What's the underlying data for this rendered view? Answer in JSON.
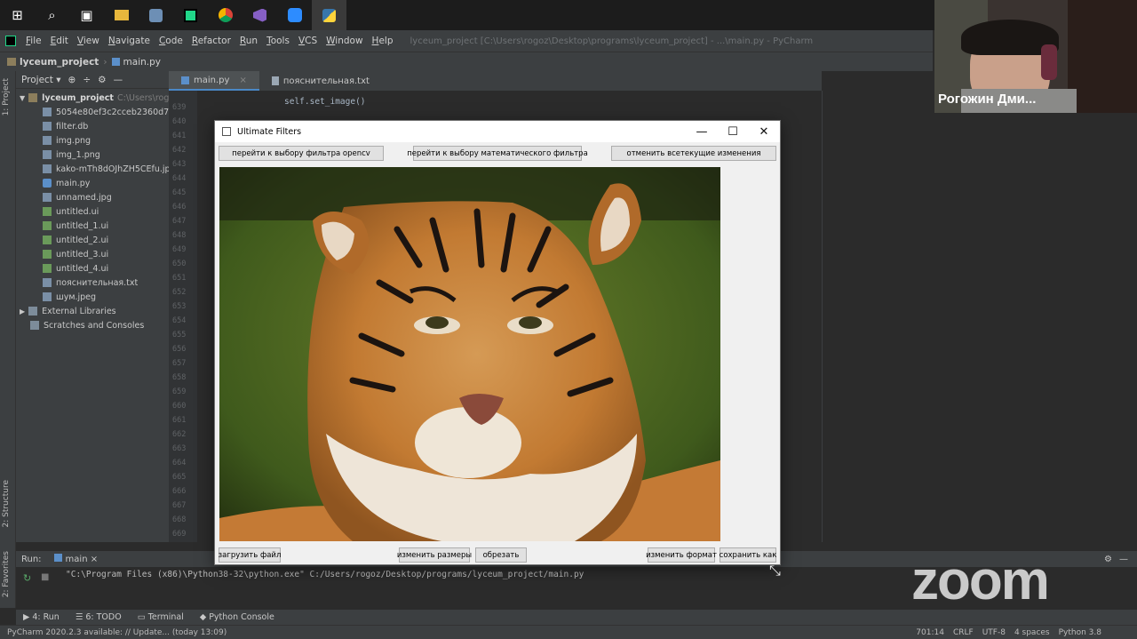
{
  "taskbar": {
    "icons": [
      "windows-start-icon",
      "search-icon",
      "task-view-icon",
      "file-explorer-icon",
      "app-icon",
      "pycharm-app-icon",
      "chrome-icon",
      "visual-studio-icon",
      "zoom-app-icon",
      "python-icon"
    ]
  },
  "menubar": {
    "items": [
      "File",
      "Edit",
      "View",
      "Navigate",
      "Code",
      "Refactor",
      "Run",
      "Tools",
      "VCS",
      "Window",
      "Help"
    ],
    "window_title": "lyceum_project [C:\\Users\\rogoz\\Desktop\\programs\\lyceum_project] - ...\\main.py - PyCharm"
  },
  "navbar": {
    "project": "lyceum_project",
    "file": "main.py"
  },
  "project_panel": {
    "header": "Project",
    "root": "lyceum_project",
    "root_path": "C:\\Users\\rogoz\\",
    "files": [
      {
        "name": "5054e80ef3c2cceb2360d77c5d",
        "kind": "file"
      },
      {
        "name": "filter.db",
        "kind": "file"
      },
      {
        "name": "img.png",
        "kind": "file"
      },
      {
        "name": "img_1.png",
        "kind": "file"
      },
      {
        "name": "kako-mTh8dOJhZH5CEfu.jpg",
        "kind": "file"
      },
      {
        "name": "main.py",
        "kind": "py"
      },
      {
        "name": "unnamed.jpg",
        "kind": "file"
      },
      {
        "name": "untitled.ui",
        "kind": "ui"
      },
      {
        "name": "untitled_1.ui",
        "kind": "ui"
      },
      {
        "name": "untitled_2.ui",
        "kind": "ui"
      },
      {
        "name": "untitled_3.ui",
        "kind": "ui"
      },
      {
        "name": "untitled_4.ui",
        "kind": "ui"
      },
      {
        "name": "пояснительная.txt",
        "kind": "file"
      },
      {
        "name": "шум.jpeg",
        "kind": "file"
      }
    ],
    "external_libraries": "External Libraries",
    "scratches": "Scratches and Consoles"
  },
  "left_stripe": {
    "project_label": "1: Project",
    "structure_label": "2: Structure",
    "favorites_label": "2: Favorites"
  },
  "editor": {
    "tabs": [
      "main.py",
      "пояснительная.txt"
    ],
    "line_numbers": [
      "639",
      "640",
      "641",
      "642",
      "643",
      "644",
      "645",
      "646",
      "647",
      "648",
      "649",
      "650",
      "651",
      "652",
      "653",
      "654",
      "655",
      "656",
      "657",
      "658",
      "659",
      "660",
      "661",
      "662",
      "663",
      "664",
      "665",
      "666",
      "667",
      "668",
      "669"
    ],
    "code_line": "self.set_image()"
  },
  "dialog": {
    "title": "Ultimate Filters",
    "minimize": "—",
    "maximize": "☐",
    "close": "✕",
    "top_buttons": [
      "перейти к выбору фильтра opencv",
      "перейти к выбору математического фильтра",
      "отменить всетекущие изменения"
    ],
    "bottom_buttons": [
      "загрузить файл",
      "изменить размеры",
      "обрезать",
      "изменить формат",
      "сохранить как"
    ]
  },
  "run_panel": {
    "label": "Run:",
    "config": "main",
    "command": "\"C:\\Program Files (x86)\\Python38-32\\python.exe\" C:/Users/rogoz/Desktop/programs/lyceum_project/main.py"
  },
  "bottom_tabs": [
    "4: Run",
    "6: TODO",
    "Terminal",
    "Python Console"
  ],
  "statusbar": {
    "message": "PyCharm 2020.2.3 available: // Update... (today 13:09)",
    "position": "701:14",
    "line_sep": "CRLF",
    "encoding": "UTF-8",
    "indent": "4 spaces",
    "interpreter": "Python 3.8"
  },
  "webcam": {
    "name": "Рогожин Дми..."
  },
  "zoom": {
    "logo": "zoom"
  }
}
